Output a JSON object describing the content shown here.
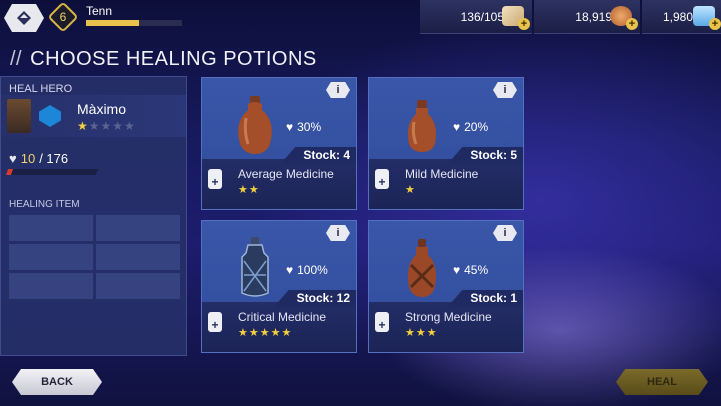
{
  "header": {
    "player_name": "Tenn",
    "level": "6",
    "xp_fraction": 0.55,
    "resources": [
      {
        "value": "136/105",
        "icon": "ticket-icon"
      },
      {
        "value": "18,919",
        "icon": "coin-stack-icon"
      },
      {
        "value": "1,980",
        "icon": "crystal-icon"
      }
    ]
  },
  "page": {
    "title": "CHOOSE HEALING POTIONS",
    "title_prefix": "//"
  },
  "hero_panel": {
    "heal_hero_label": "HEAL HERO",
    "hero_name": "Màximo",
    "stars_on": "★",
    "stars_off": "★★★★",
    "hp_current": "10",
    "hp_max": "/ 176",
    "hp_fraction": 0.06,
    "healing_item_label": "HEALING ITEM"
  },
  "potions": [
    {
      "name": "Average Medicine",
      "heal": "30%",
      "stock": "Stock: 4",
      "stars": "★★",
      "info": "i"
    },
    {
      "name": "Mild Medicine",
      "heal": "20%",
      "stock": "Stock: 5",
      "stars": "★",
      "info": "i"
    },
    {
      "name": "Critical Medicine",
      "heal": "100%",
      "stock": "Stock: 12",
      "stars": "★★★★★",
      "info": "i"
    },
    {
      "name": "Strong Medicine",
      "heal": "45%",
      "stock": "Stock: 1",
      "stars": "★★★",
      "info": "i"
    }
  ],
  "buttons": {
    "back": "BACK",
    "heal": "HEAL"
  },
  "colors": {
    "accent_gold": "#e8c24a",
    "card_blue": "#3450a0",
    "hp_red": "#d33b2f"
  }
}
